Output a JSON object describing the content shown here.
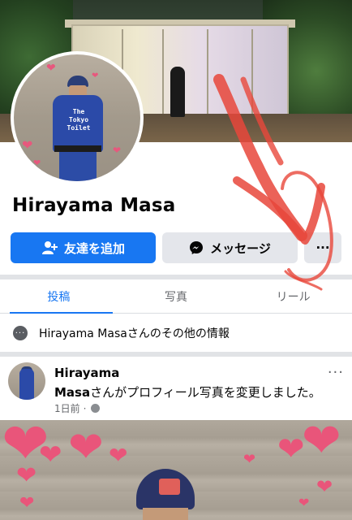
{
  "profile": {
    "name": "Hirayama Masa",
    "avatar_text": "The\nTokyo\nToilet"
  },
  "actions": {
    "add_friend_label": "友達を追加",
    "message_label": "メッセージ",
    "more_label": "···"
  },
  "tabs": [
    {
      "label": "投稿",
      "active": true
    },
    {
      "label": "写真",
      "active": false
    },
    {
      "label": "リール",
      "active": false
    }
  ],
  "info": {
    "label": "Hirayama Masaさんのその他の情報"
  },
  "post": {
    "author": "Hirayama",
    "author_rest": "Masa",
    "action_text": "さんがプロフィール写真を変更しました。",
    "time": "1日前",
    "separator": "·",
    "more_label": "···"
  },
  "colors": {
    "accent": "#1877f2",
    "annotation": "#e8473b"
  },
  "icons": {
    "add_friend": "add-friend-icon",
    "messenger": "messenger-icon",
    "more": "more-dots-icon",
    "info": "info-dots-icon",
    "globe": "globe-icon"
  }
}
